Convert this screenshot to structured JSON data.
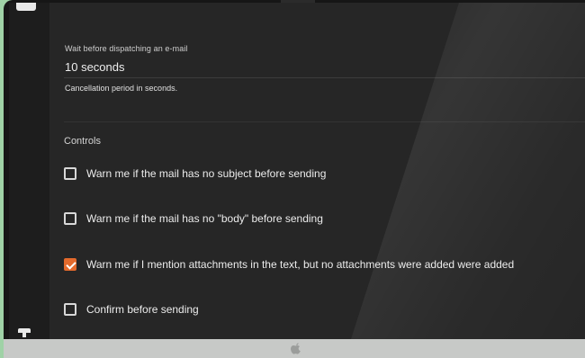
{
  "settings": {
    "delay_label": "Wait before dispatching an e-mail",
    "delay_value": "10 seconds",
    "delay_help": "Cancellation period in seconds."
  },
  "controls": {
    "heading": "Controls",
    "options": [
      {
        "label": "Warn me if the mail has no subject before sending",
        "checked": false
      },
      {
        "label": "Warn me if the mail has no \"body\" before sending",
        "checked": false
      },
      {
        "label": "Warn me if I mention attachments in the text, but no attachments were added were added",
        "checked": true
      },
      {
        "label": "Confirm before sending",
        "checked": false
      }
    ]
  },
  "colors": {
    "accent": "#e46a2c",
    "background": "#262626",
    "text": "#ececec"
  },
  "icons": {
    "sidebar_top": "menu-icon",
    "sidebar_bottom": "pin-icon",
    "bezel_logo": "apple-logo-icon",
    "checked": "checkmark-icon"
  }
}
